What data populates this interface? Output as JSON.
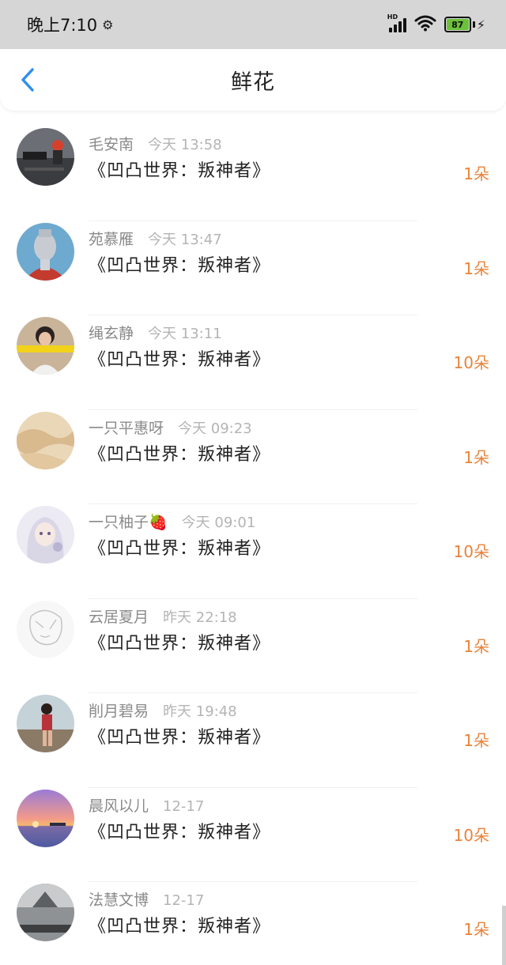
{
  "status_bar": {
    "time": "晚上7:10",
    "network_label": "HD",
    "battery": "87"
  },
  "nav": {
    "title": "鲜花"
  },
  "items": [
    {
      "name": "毛安南",
      "time": "今天 13:58",
      "title": "《凹凸世界：叛神者》",
      "count": "1朵"
    },
    {
      "name": "苑慕雁",
      "time": "今天 13:47",
      "title": "《凹凸世界：叛神者》",
      "count": "1朵"
    },
    {
      "name": "绳玄静",
      "time": "今天 13:11",
      "title": "《凹凸世界：叛神者》",
      "count": "10朵"
    },
    {
      "name": "一只平惠呀",
      "time": "今天 09:23",
      "title": "《凹凸世界：叛神者》",
      "count": "1朵"
    },
    {
      "name": "一只柚子🍓",
      "time": "今天 09:01",
      "title": "《凹凸世界：叛神者》",
      "count": "10朵"
    },
    {
      "name": "云居夏月",
      "time": "昨天 22:18",
      "title": "《凹凸世界：叛神者》",
      "count": "1朵"
    },
    {
      "name": "削月碧易",
      "time": "昨天 19:48",
      "title": "《凹凸世界：叛神者》",
      "count": "1朵"
    },
    {
      "name": "晨风以儿",
      "time": "12-17",
      "title": "《凹凸世界：叛神者》",
      "count": "10朵"
    },
    {
      "name": "法慧文博",
      "time": "12-17",
      "title": "《凹凸世界：叛神者》",
      "count": "1朵"
    }
  ],
  "colors": {
    "accent_blue": "#2f8ff0",
    "count_orange": "#e8833a"
  }
}
